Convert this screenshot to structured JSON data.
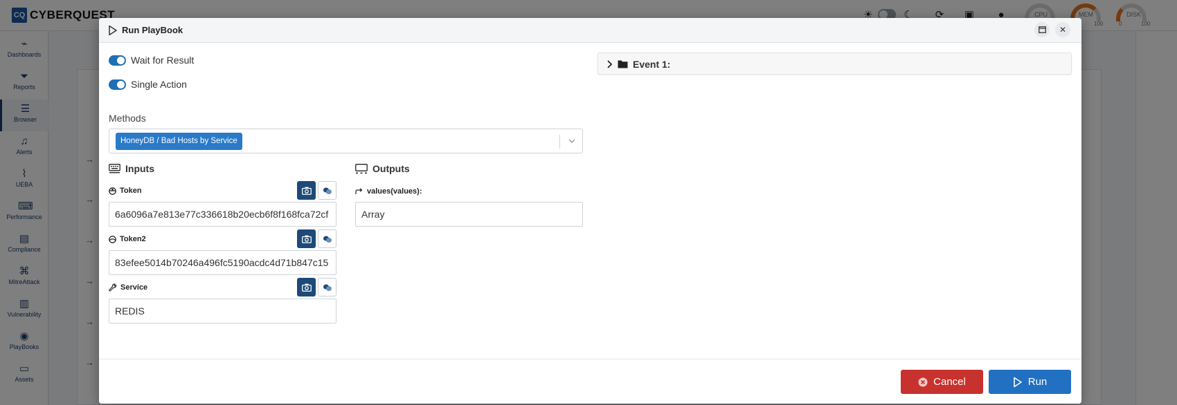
{
  "app": {
    "logo_mark": "CQ",
    "logo_text": "CYBERQUEST",
    "gauges": [
      {
        "label": "CPU",
        "min": "",
        "max": ""
      },
      {
        "label": "MEM",
        "min": "",
        "max": "100"
      },
      {
        "label": "DISK",
        "min": "0",
        "max": "100"
      }
    ],
    "sidebar": [
      {
        "label": "Dashboards",
        "icon": "chart-line-icon"
      },
      {
        "label": "Reports",
        "icon": "filter-icon"
      },
      {
        "label": "Browser",
        "icon": "list-icon"
      },
      {
        "label": "Alerts",
        "icon": "bell-icon"
      },
      {
        "label": "UEBA",
        "icon": "chart-icon"
      },
      {
        "label": "Performance",
        "icon": "keyboard-icon"
      },
      {
        "label": "Compliance",
        "icon": "document-check-icon"
      },
      {
        "label": "MitreAttack",
        "icon": "command-icon"
      },
      {
        "label": "Vulnerability",
        "icon": "server-icon"
      },
      {
        "label": "PlayBooks",
        "icon": "playbook-icon"
      },
      {
        "label": "Assets",
        "icon": "laptop-icon"
      }
    ]
  },
  "modal": {
    "title": "Run PlayBook",
    "toggles": [
      {
        "label": "Wait for Result",
        "on": true
      },
      {
        "label": "Single Action",
        "on": true
      }
    ],
    "methods": {
      "label": "Methods",
      "selected": "HoneyDB / Bad Hosts by Service"
    },
    "inputs": {
      "heading": "Inputs",
      "fields": [
        {
          "label": "Token",
          "value": "6a6096a7e813e77c336618b20ecb6f8f168fca72cf"
        },
        {
          "label": "Token2",
          "value": "83efee5014b70246a496fc5190acdc4d71b847c15"
        },
        {
          "label": "Service",
          "value": "REDIS"
        }
      ]
    },
    "outputs": {
      "heading": "Outputs",
      "fields": [
        {
          "label": "values(values):",
          "value": "Array"
        }
      ]
    },
    "event": {
      "label": "Event 1:"
    },
    "footer": {
      "cancel_label": "Cancel",
      "run_label": "Run"
    }
  }
}
